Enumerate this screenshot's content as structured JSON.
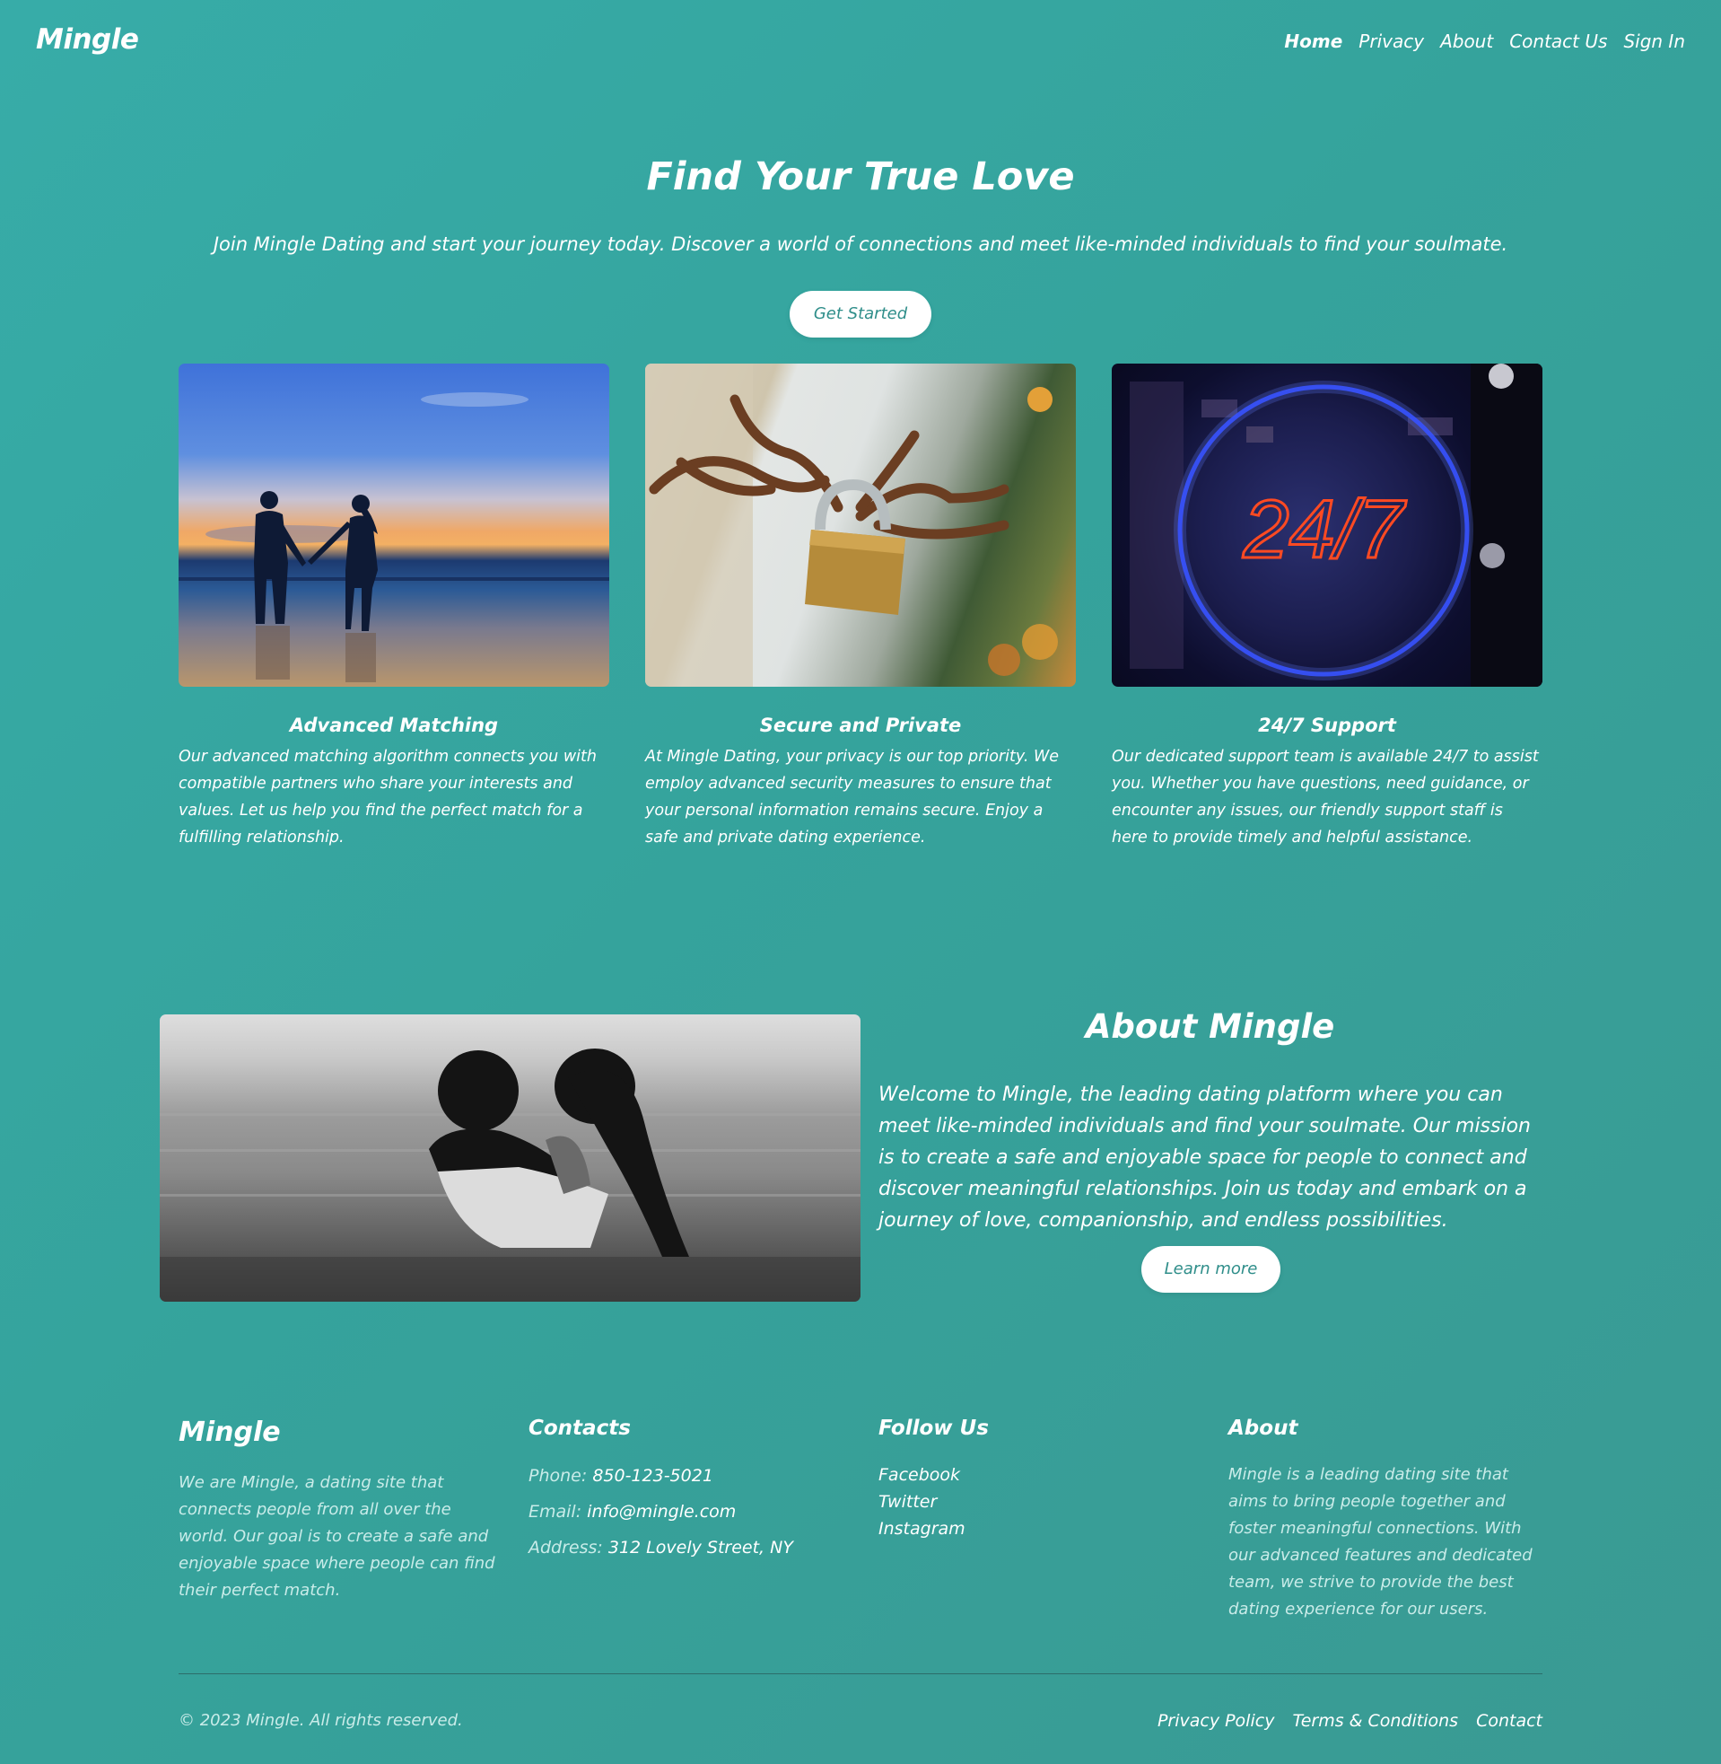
{
  "nav": {
    "brand": "Mingle",
    "links": [
      "Home",
      "Privacy",
      "About",
      "Contact Us",
      "Sign In"
    ]
  },
  "hero": {
    "title": "Find Your True Love",
    "subtitle": "Join Mingle Dating and start your journey today. Discover a world of connections and meet like-minded individuals to find your soulmate.",
    "cta": "Get Started"
  },
  "features": [
    {
      "title": "Advanced Matching",
      "text": "Our advanced matching algorithm connects you with compatible partners who share your interests and values. Let us help you find the perfect match for a fulfilling relationship.",
      "image": "couple-beach-sunset-image"
    },
    {
      "title": "Secure and Private",
      "text": "At Mingle Dating, your privacy is our top priority. We employ advanced security measures to ensure that your personal information remains secure. Enjoy a safe and private dating experience.",
      "image": "padlock-chain-image"
    },
    {
      "title": "24/7 Support",
      "text": "Our dedicated support team is available 24/7 to assist you. Whether you have questions, need guidance, or encounter any issues, our friendly support staff is here to provide timely and helpful assistance.",
      "image": "neon-24-7-sign-image",
      "sign_text": "24/7"
    }
  ],
  "about": {
    "title": "About Mingle",
    "text": "Welcome to Mingle, the leading dating platform where you can meet like-minded individuals and find your soulmate. Our mission is to create a safe and enjoyable space for people to connect and discover meaningful relationships. Join us today and embark on a journey of love, companionship, and endless possibilities.",
    "cta": "Learn more"
  },
  "footer": {
    "brand": "Mingle",
    "brand_desc": "We are Mingle, a dating site that connects people from all over the world. Our goal is to create a safe and enjoyable space where people can find their perfect match.",
    "contacts_title": "Contacts",
    "phone_label": "Phone:",
    "phone": "850-123-5021",
    "email_label": "Email:",
    "email": "info@mingle.com",
    "address_label": "Address:",
    "address": "312 Lovely Street, NY",
    "follow_title": "Follow Us",
    "social": [
      "Facebook",
      "Twitter",
      "Instagram"
    ],
    "about_title": "About",
    "about_desc": "Mingle is a leading dating site that aims to bring people together and foster meaningful connections. With our advanced features and dedicated team, we strive to provide the best dating experience for our users.",
    "copyright": "© 2023 Mingle. All rights reserved.",
    "bottom_links": [
      "Privacy Policy",
      "Terms & Conditions",
      "Contact"
    ]
  }
}
